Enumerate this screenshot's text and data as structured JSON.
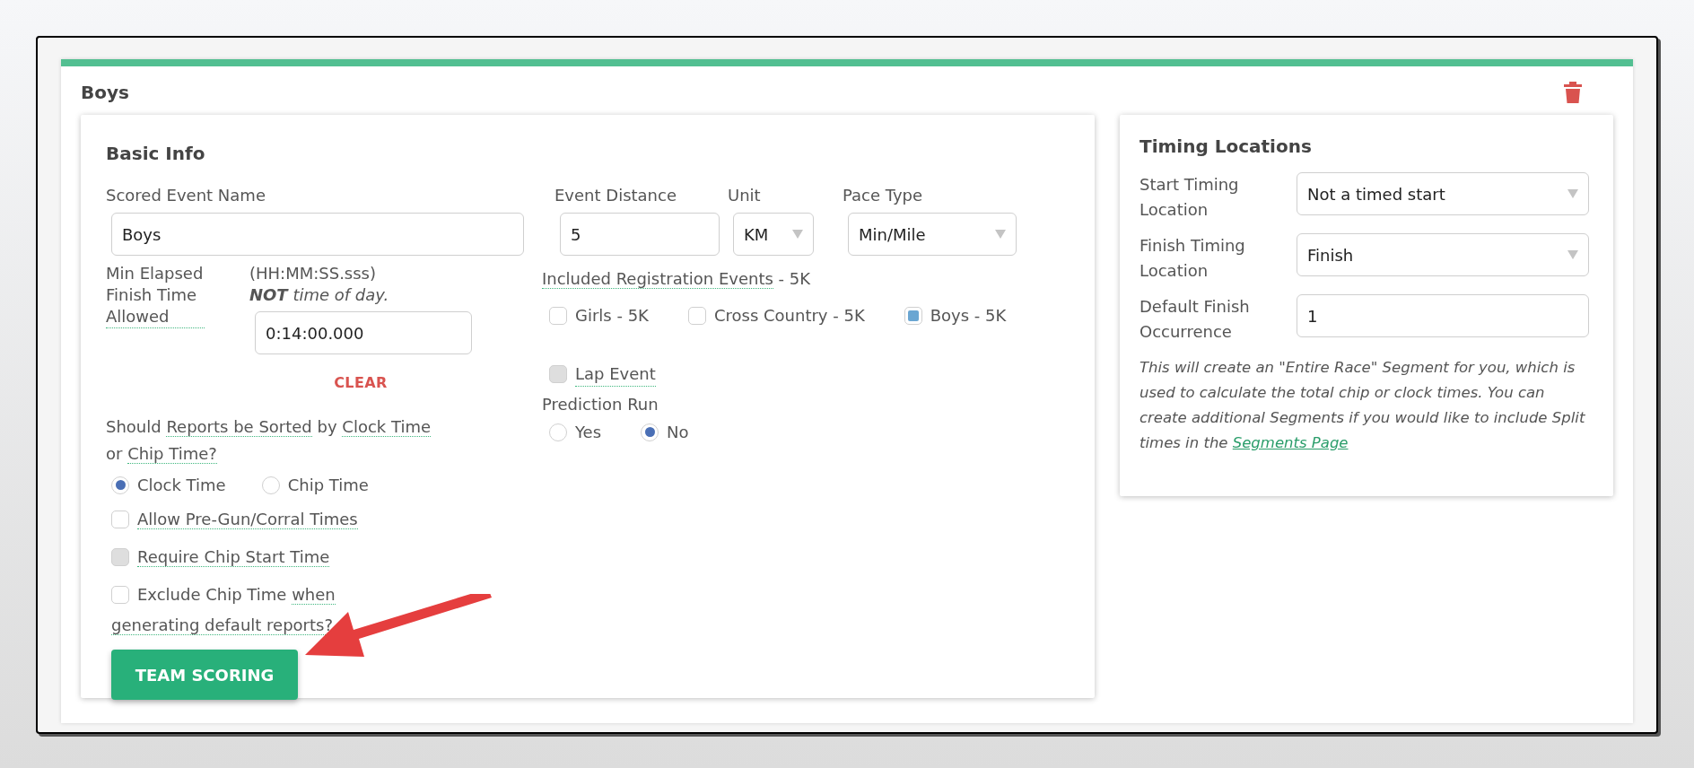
{
  "section_title": "Boys",
  "basic_info": {
    "title": "Basic Info",
    "event_name": {
      "label": "Scored Event Name",
      "value": "Boys"
    },
    "event_distance": {
      "label": "Event Distance",
      "value": "5"
    },
    "unit": {
      "label": "Unit",
      "value": "KM"
    },
    "pace_type": {
      "label": "Pace Type",
      "value": "Min/Mile"
    },
    "min_elapsed": {
      "label": "Min Elapsed Finish Time Allowed",
      "format": "(HH:MM:SS.sss)",
      "note": "**NOT** time of day.",
      "value": "0:14:00.000",
      "clear": "CLEAR"
    },
    "included_events": {
      "label": "Included Registration Events",
      "suffix": " - 5K",
      "items": [
        {
          "label": "Girls - 5K",
          "checked": false
        },
        {
          "label": "Cross Country - 5K",
          "checked": false
        },
        {
          "label": "Boys - 5K",
          "checked": true
        }
      ]
    },
    "lap_event": {
      "label": "Lap Event",
      "checked": false,
      "disabled": true
    },
    "prediction_run": {
      "label": "Prediction Run",
      "options": [
        {
          "label": "Yes",
          "selected": false
        },
        {
          "label": "No",
          "selected": true
        }
      ]
    },
    "sort_question": [
      {
        "text": "Should ",
        "hint": false
      },
      {
        "text": "Reports be Sorted",
        "hint": true
      },
      {
        "text": " by ",
        "hint": false
      },
      {
        "text": "Clock Time",
        "hint": true
      },
      {
        "text": " or ",
        "hint": false
      },
      {
        "text": "Chip Time?",
        "hint": true
      }
    ],
    "sort_options": [
      {
        "label": "Clock Time",
        "selected": true
      },
      {
        "label": "Chip Time",
        "selected": false
      }
    ],
    "options": [
      {
        "parts": [
          {
            "text": "Allow Pre-Gun/Corral Times",
            "hint": true
          }
        ],
        "checked": false,
        "disabled": false
      },
      {
        "parts": [
          {
            "text": "Require Chip Start Time",
            "hint": true
          }
        ],
        "checked": false,
        "disabled": true
      },
      {
        "parts": [
          {
            "text": "Exclude Chip Time ",
            "hint": false
          },
          {
            "text": "when generating default reports?",
            "hint": true
          }
        ],
        "checked": false,
        "disabled": false
      }
    ],
    "team_scoring": "TEAM SCORING"
  },
  "timing": {
    "title": "Timing Locations",
    "fields": [
      {
        "kind": "select",
        "label": "Start Timing Location",
        "value": "Not a timed start"
      },
      {
        "kind": "select",
        "label": "Finish Timing Location",
        "value": "Finish"
      },
      {
        "kind": "input",
        "label": "Default Finish Occurrence",
        "value": "1"
      }
    ],
    "note": "This will create an \"Entire Race\" Segment for you, which is used to calculate the total chip or clock times. You can create additional Segments if you would like to include Split times in the ",
    "link": "Segments Page"
  }
}
